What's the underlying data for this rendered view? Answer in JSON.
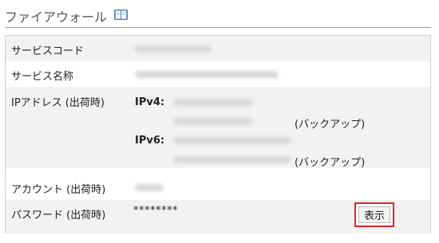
{
  "header": {
    "title": "ファイアウォール",
    "icon": "book-icon"
  },
  "rows": {
    "service_code": {
      "label": "サービスコード"
    },
    "service_name": {
      "label": "サービス名称"
    },
    "ip_address": {
      "label": "IPアドレス (出荷時)",
      "ipv4_label": "IPv4:",
      "ipv6_label": "IPv6:",
      "backup_note": "(バックアップ)"
    },
    "account": {
      "label": "アカウント (出荷時)"
    },
    "password": {
      "label": "パスワード (出荷時)",
      "masked_value": "********"
    }
  },
  "show_button": {
    "label": "表示",
    "highlight_color": "#e0232b"
  }
}
